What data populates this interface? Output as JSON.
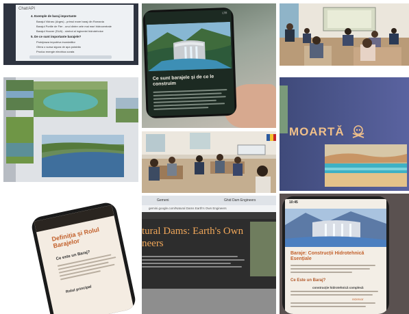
{
  "collage": {
    "tile1_doc": {
      "header": "Chat/API",
      "lines": [
        "4. Exemple de baraj importante",
        "Barajul Vidraru (Arges) - primul mare baraj din Romania",
        "Barajul Portile de Fier - unul dintre cele mai mari hidrocentrale",
        "Barajul Hoover (SUA) - simbol al ingineriei hidrotehnice",
        "5. De ce sunt importante barajele?",
        "Protejeaza impotriva inundatiilor",
        "Ofera o sursa sigura de apa potabila",
        "Produc energie electrica curata"
      ]
    },
    "tile2_phone": {
      "headline": "Ce sunt barajele și de ce le construim",
      "status": "LTE"
    },
    "tile3_class": {},
    "tile4_slides": {},
    "tile5_class": {},
    "tile6_slide": {
      "word": "MOARTĂ",
      "icon": "skull-crossbones-icon"
    },
    "tile7_phone": {
      "title": "Definiția și Rolul Barajelor",
      "question": "Ce este un Baraj?",
      "section": "Rolul principal"
    },
    "tile8_laptop": {
      "tab1": "Gemeni",
      "tab2": "Ghid Dam Engineers",
      "url": "gemini.google.com/Natural Dams Earth's Own Engineers",
      "heading_line1": "tural Dams: Earth's Own",
      "heading_line2": "neers"
    },
    "tile9_phone": {
      "time": "10:45",
      "title": "Baraje: Construcții Hidrotehnică Esențiale",
      "question": "Ce Este un Baraj?",
      "body_bold": "construcție hidrotehnică complexă",
      "body_link": "rezervor"
    }
  }
}
